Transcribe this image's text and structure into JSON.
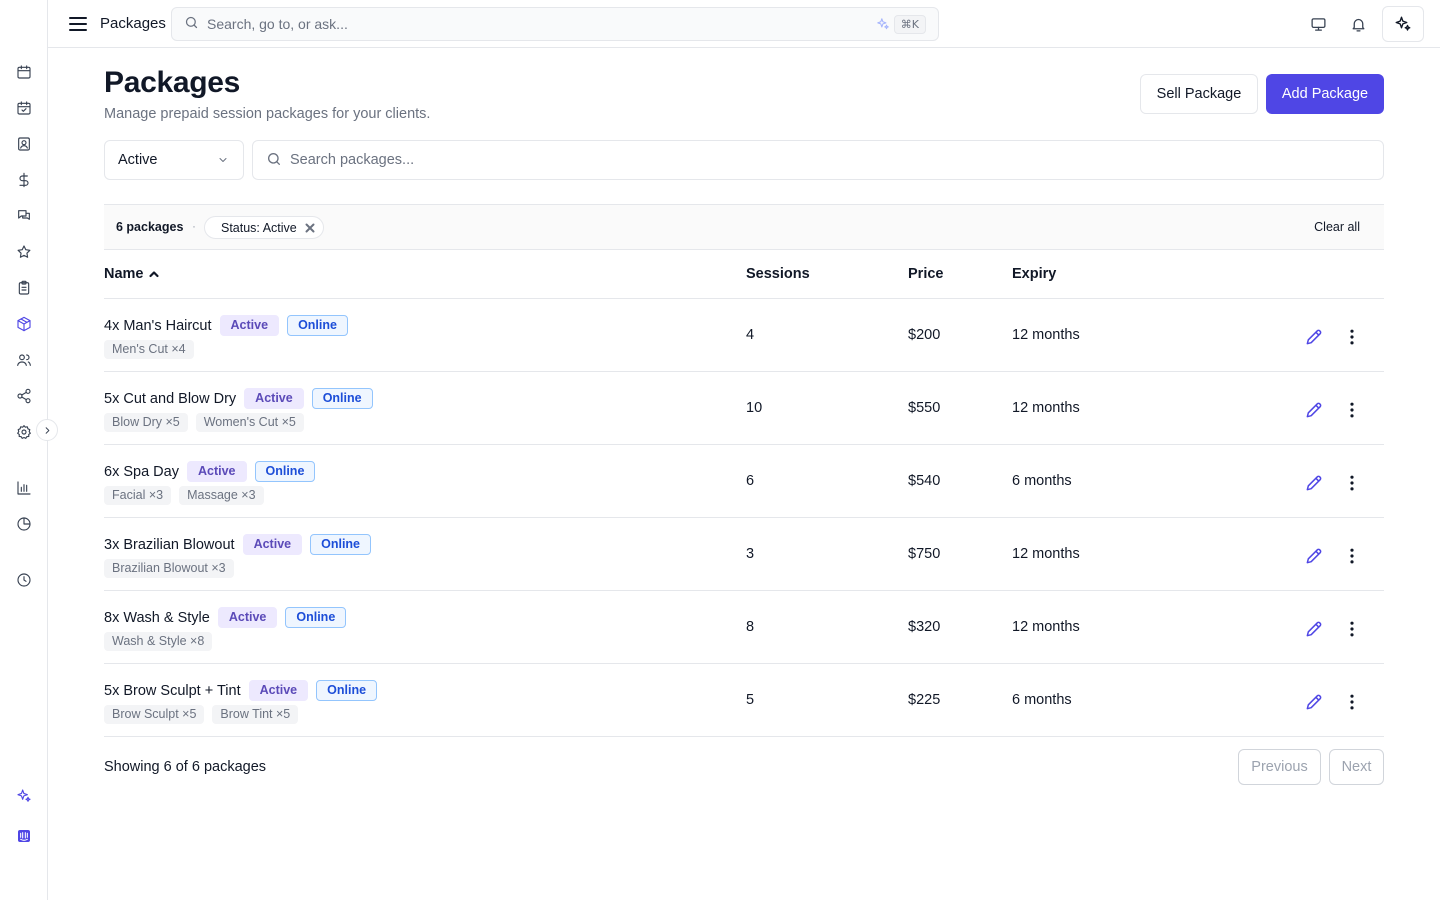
{
  "topbar": {
    "title": "Packages",
    "search_placeholder": "Search, go to, or ask...",
    "shortcut": "⌘K"
  },
  "sidebar": {
    "icons": [
      "calendar-icon",
      "calendar-check-icon",
      "contact-card-icon",
      "dollar-icon",
      "chat-icon",
      "star-icon",
      "clipboard-icon",
      "package-icon",
      "users-icon",
      "share-icon",
      "settings-icon",
      "bar-chart-icon",
      "pie-chart-icon",
      "clock-icon",
      "sparkle-icon",
      "intercom-icon"
    ],
    "active": "package-icon"
  },
  "page": {
    "title": "Packages",
    "subtitle": "Manage prepaid session packages for your clients.",
    "sell_label": "Sell Package",
    "add_label": "Add Package"
  },
  "filters": {
    "status_value": "Active",
    "search_placeholder": "Search packages...",
    "count_label": "6 packages",
    "separator": "·",
    "chip_label": "Status: Active",
    "clear_label": "Clear all"
  },
  "table": {
    "columns": {
      "name": "Name",
      "sessions": "Sessions",
      "price": "Price",
      "expiry": "Expiry"
    },
    "rows": [
      {
        "name": "4x Man's Haircut",
        "status": "Active",
        "channel": "Online",
        "services": [
          "Men's Cut ×4"
        ],
        "sessions": "4",
        "price": "$200",
        "expiry": "12 months"
      },
      {
        "name": "5x Cut and Blow Dry",
        "status": "Active",
        "channel": "Online",
        "services": [
          "Blow Dry ×5",
          "Women's Cut ×5"
        ],
        "sessions": "10",
        "price": "$550",
        "expiry": "12 months"
      },
      {
        "name": "6x Spa Day",
        "status": "Active",
        "channel": "Online",
        "services": [
          "Facial ×3",
          "Massage ×3"
        ],
        "sessions": "6",
        "price": "$540",
        "expiry": "6 months"
      },
      {
        "name": "3x Brazilian Blowout",
        "status": "Active",
        "channel": "Online",
        "services": [
          "Brazilian Blowout ×3"
        ],
        "sessions": "3",
        "price": "$750",
        "expiry": "12 months"
      },
      {
        "name": "8x Wash & Style",
        "status": "Active",
        "channel": "Online",
        "services": [
          "Wash & Style ×8"
        ],
        "sessions": "8",
        "price": "$320",
        "expiry": "12 months"
      },
      {
        "name": "5x Brow Sculpt + Tint",
        "status": "Active",
        "channel": "Online",
        "services": [
          "Brow Sculpt ×5",
          "Brow Tint ×5"
        ],
        "sessions": "5",
        "price": "$225",
        "expiry": "6 months"
      }
    ]
  },
  "footer": {
    "showing": "Showing 6 of 6 packages",
    "prev_label": "Previous",
    "next_label": "Next"
  },
  "colors": {
    "accent": "#4f46e5",
    "active_badge_bg": "#ede9fe",
    "online_badge_border": "#93c5fd"
  }
}
